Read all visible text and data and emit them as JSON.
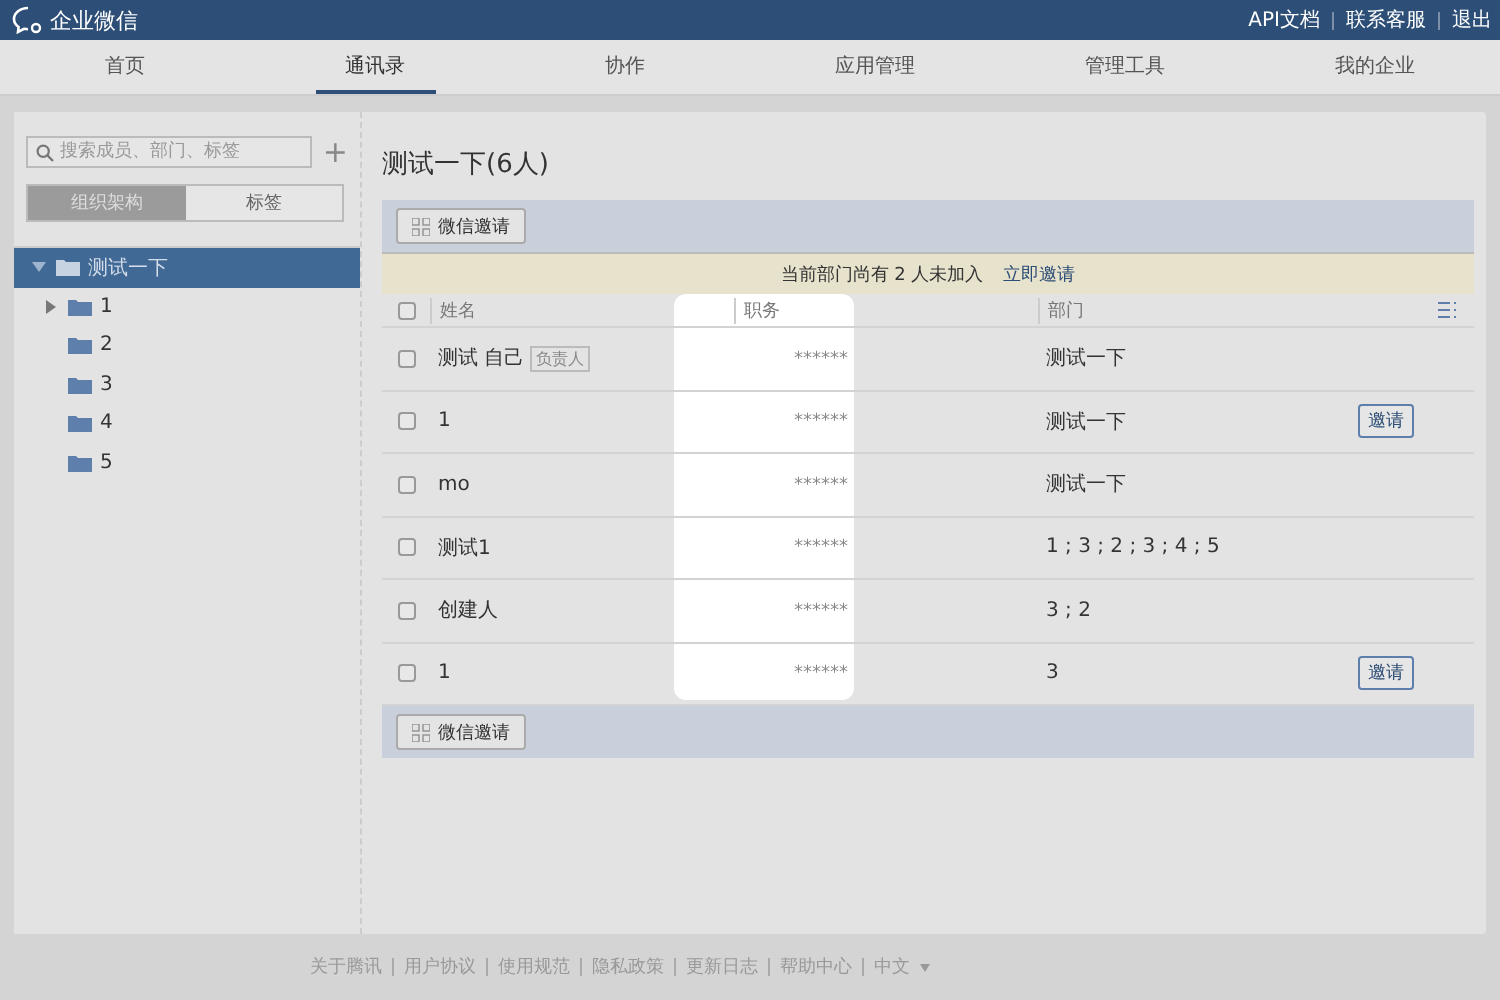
{
  "brand": "企业微信",
  "top_links": [
    "API文档",
    "联系客服",
    "退出"
  ],
  "nav": [
    {
      "label": "首页",
      "selected": false
    },
    {
      "label": "通讯录",
      "selected": true
    },
    {
      "label": "协作",
      "selected": false
    },
    {
      "label": "应用管理",
      "selected": false
    },
    {
      "label": "管理工具",
      "selected": false
    },
    {
      "label": "我的企业",
      "selected": false
    }
  ],
  "sidebar": {
    "search": {
      "placeholder": "搜索成员、部门、标签"
    },
    "add": "+",
    "tabs": [
      {
        "label": "组织架构",
        "selected": true
      },
      {
        "label": "标签",
        "selected": false
      }
    ],
    "tree": [
      {
        "label": "测试一下",
        "selected": true,
        "kind": "branch",
        "expanded": true,
        "children": [
          {
            "label": "1",
            "selected": false,
            "kind": "branch",
            "expanded": false
          },
          {
            "label": "2",
            "selected": false,
            "kind": "leaf"
          },
          {
            "label": "3",
            "selected": false,
            "kind": "leaf"
          },
          {
            "label": "4",
            "selected": false,
            "kind": "leaf"
          },
          {
            "label": "5",
            "selected": false,
            "kind": "leaf"
          }
        ]
      }
    ]
  },
  "main": {
    "title": "测试一下(6人)",
    "toolbar_button": "微信邀请",
    "notice": {
      "text": "当前部门尚有 2 人未加入",
      "link": "立即邀请"
    },
    "table": {
      "columns": [
        "姓名",
        "职务",
        "部门"
      ],
      "header_checked": false,
      "rows": [
        {
          "checked": false,
          "name": "测试 自己",
          "badge": "负责人",
          "job": "******",
          "dept": "测试一下"
        },
        {
          "checked": false,
          "name": "1",
          "job": "******",
          "dept": "测试一下",
          "action": "邀请"
        },
        {
          "checked": false,
          "name": "mo",
          "job": "******",
          "dept": "测试一下"
        },
        {
          "checked": false,
          "name": "测试1",
          "job": "******",
          "dept": "1 ; 3 ; 2 ; 3 ; 4 ; 5"
        },
        {
          "checked": false,
          "name": "创建人",
          "job": "******",
          "dept": "3 ; 2"
        },
        {
          "checked": false,
          "name": "1",
          "job": "******",
          "dept": "3",
          "action": "邀请"
        }
      ]
    },
    "bottom_button": "微信邀请"
  },
  "footer": {
    "links": [
      "关于腾讯",
      "用户协议",
      "使用规范",
      "隐私政策",
      "更新日志",
      "帮助中心"
    ],
    "language": "中文"
  }
}
